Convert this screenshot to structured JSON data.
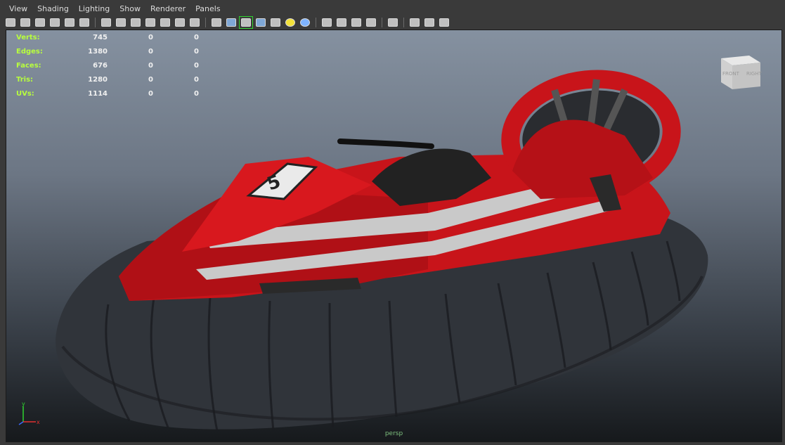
{
  "menu": [
    "View",
    "Shading",
    "Lighting",
    "Show",
    "Renderer",
    "Panels"
  ],
  "toolbar_icons": [
    "select-camera-icon",
    "lock-camera-icon",
    "bookmark-icon",
    "image-plane-icon",
    "2d-pan-icon",
    "grease-pencil-icon",
    "separator",
    "grid-icon",
    "film-gate-icon",
    "resolution-gate-icon",
    "gate-mask-icon",
    "field-chart-icon",
    "safe-action-icon",
    "safe-title-icon",
    "separator",
    "wireframe-icon",
    "smooth-shade-icon",
    "wireframe-on-shaded-icon",
    "default-material-icon",
    "textured-icon",
    "use-all-lights-icon",
    "shadows-icon",
    "separator",
    "screen-space-ao-icon",
    "motion-blur-icon",
    "multisample-aa-icon",
    "depth-of-field-icon",
    "separator",
    "isolate-select-icon",
    "separator",
    "xray-icon",
    "xray-active-components-icon",
    "xray-joints-icon"
  ],
  "stats": [
    {
      "label": "Verts:",
      "v1": "745",
      "v2": "0",
      "v3": "0"
    },
    {
      "label": "Edges:",
      "v1": "1380",
      "v2": "0",
      "v3": "0"
    },
    {
      "label": "Faces:",
      "v1": "676",
      "v2": "0",
      "v3": "0"
    },
    {
      "label": "Tris:",
      "v1": "1280",
      "v2": "0",
      "v3": "0"
    },
    {
      "label": "UVs:",
      "v1": "1114",
      "v2": "0",
      "v3": "0"
    }
  ],
  "viewcube": {
    "front": "FRONT",
    "right": "RIGHT"
  },
  "axis": {
    "x": "x",
    "y": "y"
  },
  "camera_label": "persp",
  "colors": {
    "hull_red": "#c8141a",
    "skirt": "#2e3238",
    "stripe": "#c9c9c9"
  }
}
